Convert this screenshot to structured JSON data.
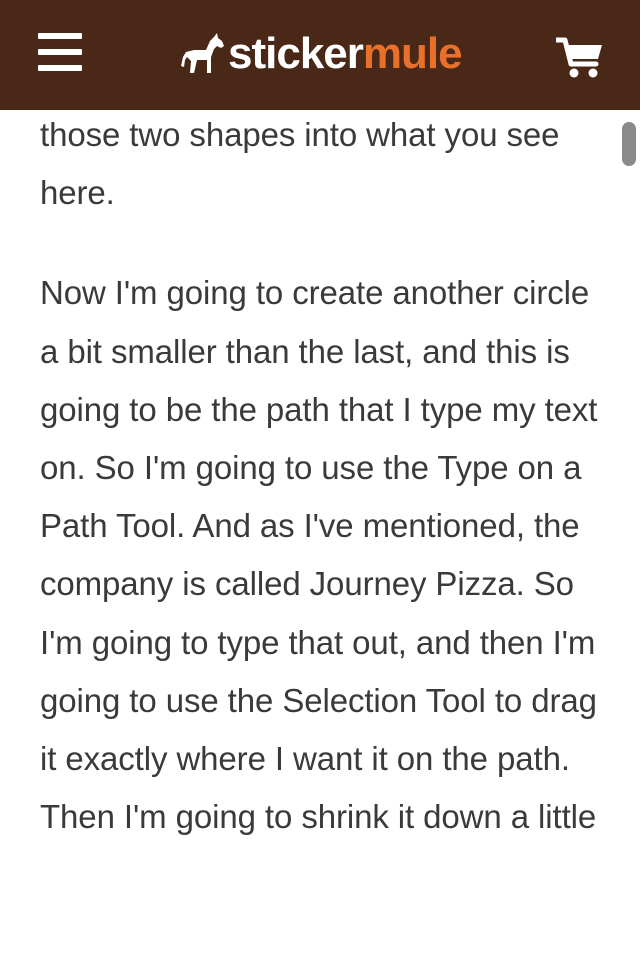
{
  "header": {
    "logo_part1": "sticker",
    "logo_part2": "mule",
    "menu_icon": "hamburger-menu-icon",
    "cart_icon": "shopping-cart-icon",
    "background_color": "#4a2818",
    "accent_color": "#e8702a"
  },
  "article": {
    "paragraphs": [
      "those two shapes into what you see here.",
      "Now I'm going to create another circle a bit smaller than the last, and this is going to be the path that I type my text on. So I'm going to use the Type on a Path Tool. And as I've mentioned, the company is called Journey Pizza. So I'm going to type that out, and then I'm going to use the Selection Tool to drag it exactly where I want it on the path. Then I'm going to shrink it down a little"
    ]
  }
}
